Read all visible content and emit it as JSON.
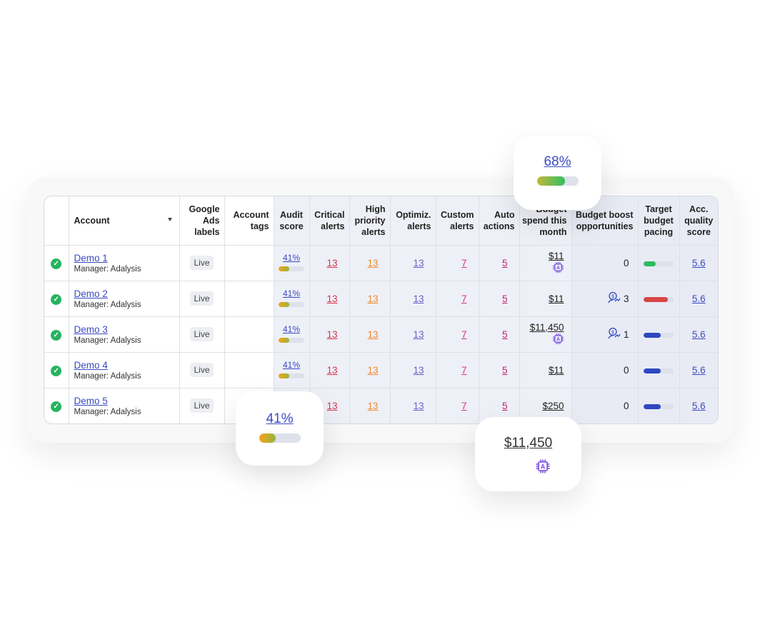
{
  "table": {
    "headers": {
      "account": "Account",
      "labels": [
        "Google",
        "Ads",
        "labels"
      ],
      "tags": [
        "Account",
        "tags"
      ],
      "audit": [
        "Audit",
        "score"
      ],
      "critical": [
        "Critical",
        "alerts"
      ],
      "high": [
        "High",
        "priority",
        "alerts"
      ],
      "optimiz": [
        "Optimiz.",
        "alerts"
      ],
      "custom": [
        "Custom",
        "alerts"
      ],
      "auto": [
        "Auto",
        "actions"
      ],
      "budget": [
        "Budget",
        "spend this",
        "month"
      ],
      "boost": [
        "Budget boost",
        "opportunities"
      ],
      "pacing": [
        "Target",
        "budget",
        "pacing"
      ],
      "quality": [
        "Acc.",
        "quality",
        "score"
      ]
    },
    "rows": [
      {
        "name": "Demo 1",
        "manager": "Manager: Adalysis",
        "label": "Live",
        "audit": "41%",
        "audit_pct": 41,
        "critical": "13",
        "high": "13",
        "optimiz": "13",
        "custom": "7",
        "auto": "5",
        "budget": "$11",
        "budget_ai": true,
        "boost": "0",
        "boost_icon": false,
        "pacing_pct": 40,
        "pacing_color": "#2dbb62",
        "quality": "5.6"
      },
      {
        "name": "Demo 2",
        "manager": "Manager: Adalysis",
        "label": "Live",
        "audit": "41%",
        "audit_pct": 41,
        "critical": "13",
        "high": "13",
        "optimiz": "13",
        "custom": "7",
        "auto": "5",
        "budget": "$11",
        "budget_ai": false,
        "boost": "3",
        "boost_icon": true,
        "pacing_pct": 80,
        "pacing_color": "#d94545",
        "quality": "5.6"
      },
      {
        "name": "Demo 3",
        "manager": "Manager: Adalysis",
        "label": "Live",
        "audit": "41%",
        "audit_pct": 41,
        "critical": "13",
        "high": "13",
        "optimiz": "13",
        "custom": "7",
        "auto": "5",
        "budget": "$11,450",
        "budget_ai": true,
        "boost": "1",
        "boost_icon": true,
        "pacing_pct": 58,
        "pacing_color": "#2f47c0",
        "quality": "5.6"
      },
      {
        "name": "Demo 4",
        "manager": "Manager: Adalysis",
        "label": "Live",
        "audit": "41%",
        "audit_pct": 41,
        "critical": "13",
        "high": "13",
        "optimiz": "13",
        "custom": "7",
        "auto": "5",
        "budget": "$11",
        "budget_ai": false,
        "boost": "0",
        "boost_icon": false,
        "pacing_pct": 58,
        "pacing_color": "#2f47c0",
        "quality": "5.6"
      },
      {
        "name": "Demo 5",
        "manager": "Manager: Adalysis",
        "label": "Live",
        "audit": "41%",
        "audit_pct": 41,
        "critical": "13",
        "high": "13",
        "optimiz": "13",
        "custom": "7",
        "auto": "5",
        "budget": "$250",
        "budget_ai": false,
        "boost": "0",
        "boost_icon": false,
        "pacing_pct": 58,
        "pacing_color": "#2f47c0",
        "quality": "5.6"
      }
    ]
  },
  "floats": {
    "score_high": {
      "value": "68%",
      "pct": 68
    },
    "score_audit": {
      "value": "41%",
      "pct": 41
    },
    "budget": {
      "value": "$11,450"
    }
  },
  "colors": {
    "link": "#3a4bc2",
    "critical": "#d8354b",
    "high": "#ee8a2c",
    "optimiz": "#6b5fc9",
    "custom": "#d4327e",
    "ai_icon": "#7b4fe0"
  },
  "icons": {
    "status": "check-circle-icon",
    "ai": "ai-chip-icon",
    "boost": "money-growth-icon",
    "sort": "caret-down-icon"
  }
}
